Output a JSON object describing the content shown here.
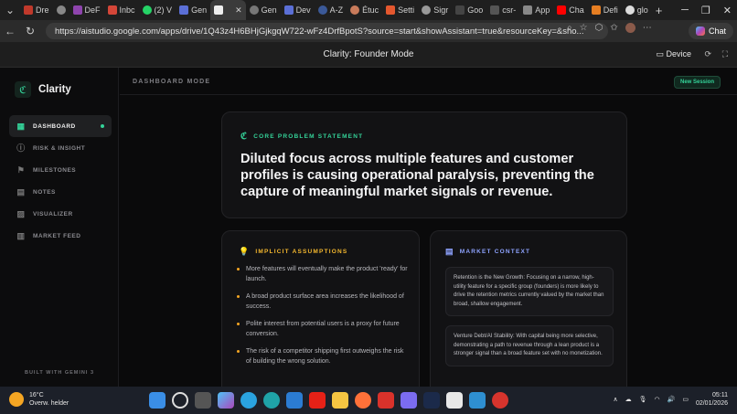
{
  "browser": {
    "tabs": [
      "Dre",
      "",
      "DeF",
      "Inbc",
      "(2) V",
      "Gen",
      "",
      "Gen",
      "Dev",
      "A-Z",
      "Étuc",
      "Setti",
      "Sigr",
      "Goo",
      "csr-",
      "App",
      "Cha",
      "Defi",
      "glo"
    ],
    "url": "https://aistudio.google.com/apps/drive/1Q43z4H6BHjGjkgqW722-wFz4DrfBpotS?source=start&showAssistant=true&resourceKey=&sho...",
    "chat_label": "Chat"
  },
  "app_header": {
    "title": "Clarity: Founder Mode",
    "device_label": "Device"
  },
  "sidebar": {
    "brand": "Clarity",
    "items": [
      {
        "label": "DASHBOARD",
        "icon": "grid-icon"
      },
      {
        "label": "RISK & INSIGHT",
        "icon": "alert-icon"
      },
      {
        "label": "MILESTONES",
        "icon": "flag-icon"
      },
      {
        "label": "NOTES",
        "icon": "note-icon"
      },
      {
        "label": "VISUALIZER",
        "icon": "image-icon"
      },
      {
        "label": "MARKET FEED",
        "icon": "feed-icon"
      }
    ],
    "footer": "BUILT WITH GEMINI 3"
  },
  "topbar": {
    "mode": "DASHBOARD MODE",
    "new_session": "New Session"
  },
  "problem": {
    "label": "CORE PROBLEM STATEMENT",
    "text": "Diluted focus across multiple features and customer profiles is causing operational paralysis, preventing the capture of meaningful market signals or revenue."
  },
  "assumptions": {
    "label": "IMPLICIT ASSUMPTIONS",
    "items": [
      "More features will eventually make the product 'ready' for launch.",
      "A broad product surface area increases the likelihood of success.",
      "Polite interest from potential users is a proxy for future conversion.",
      "The risk of a competitor shipping first outweighs the risk of building the wrong solution."
    ]
  },
  "market": {
    "label": "MARKET CONTEXT",
    "items": [
      "Retention is the New Growth: Focusing on a narrow, high-utility feature for a specific group (founders) is more likely to drive the retention metrics currently valued by the market than broad, shallow engagement.",
      "Venture Debt/AI Stability: With capital being more selective, demonstrating a path to revenue through a lean product is a stronger signal than a broad feature set with no monetization."
    ]
  },
  "taskbar": {
    "temp": "16°C",
    "weather": "Overw. helder",
    "time": "05:11",
    "date": "02/01/2026"
  },
  "colors": {
    "accent_green": "#34d399",
    "accent_amber": "#f5b82e",
    "accent_blue": "#8ea3ff"
  }
}
